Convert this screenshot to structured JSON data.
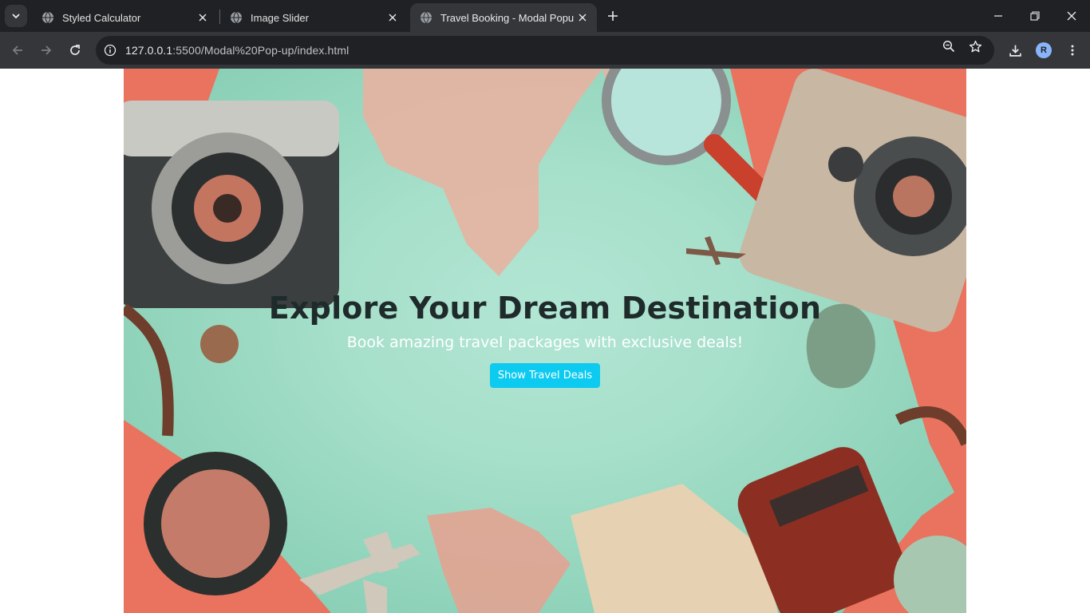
{
  "browser": {
    "tabs": [
      {
        "label": "Styled Calculator",
        "active": false
      },
      {
        "label": "Image Slider",
        "active": false
      },
      {
        "label": "Travel Booking - Modal Popup",
        "active": true
      }
    ],
    "url_host": "127.0.0.1",
    "url_path": ":5500/Modal%20Pop-up/index.html",
    "profile_initial": "R",
    "icons": {
      "tab_search": "chevron-down-icon",
      "favicon": "globe-icon",
      "tab_close": "close-icon",
      "new_tab": "plus-icon",
      "back": "arrow-left-icon",
      "forward": "arrow-right-icon",
      "reload": "reload-icon",
      "site_info": "info-icon",
      "zoom": "zoom-out-icon",
      "bookmark": "star-icon",
      "downloads": "download-icon",
      "menu": "kebab-menu-icon",
      "minimize": "minimize-icon",
      "restore": "restore-icon",
      "close_window": "close-icon"
    }
  },
  "hero": {
    "title": "Explore Your Dream Destination",
    "subtitle": "Book amazing travel packages with exclusive deals!",
    "button_label": "Show Travel Deals",
    "colors": {
      "background": "#a6dfca",
      "accent_coral": "#e9735e",
      "button": "#0dcaf0",
      "title": "#1f2a2b"
    }
  }
}
